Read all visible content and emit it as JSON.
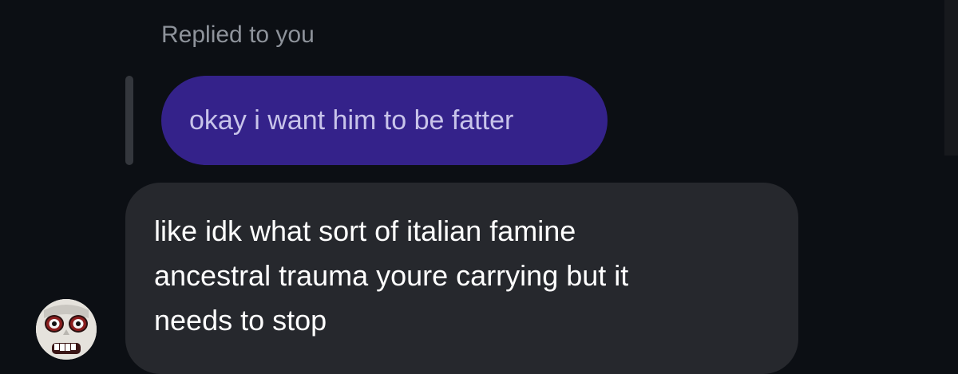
{
  "reply": {
    "label": "Replied to you",
    "quoted_text": "okay i want him to be fatter"
  },
  "message": {
    "lines": [
      "like idk what sort of italian famine",
      "ancestral trauma youre carrying but it",
      "needs to stop"
    ]
  },
  "colors": {
    "background": "#0c0f14",
    "quoted_bubble": "#34228a",
    "message_bubble": "#26282d",
    "secondary_text": "#8e939b"
  },
  "icons": {
    "avatar": "creepy-doll-face-avatar"
  }
}
